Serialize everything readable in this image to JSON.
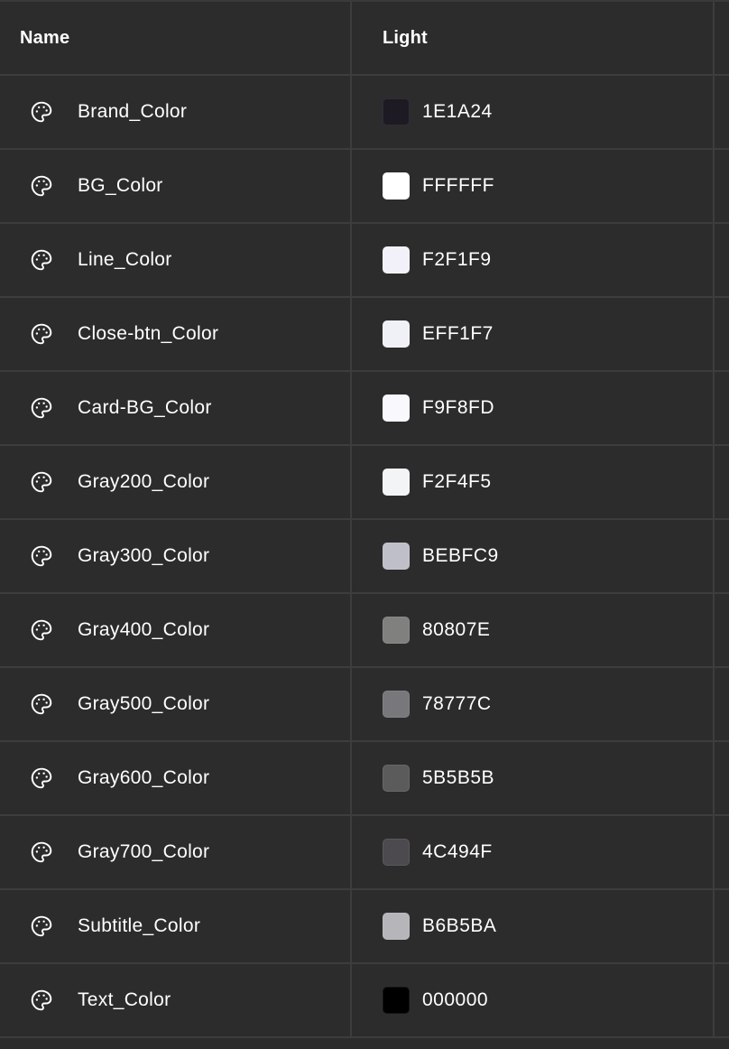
{
  "header": {
    "name_label": "Name",
    "light_label": "Light"
  },
  "rows": [
    {
      "name": "Brand_Color",
      "hex": "1E1A24",
      "swatch": "#1E1A24",
      "icon": "palette-icon"
    },
    {
      "name": "BG_Color",
      "hex": "FFFFFF",
      "swatch": "#FFFFFF",
      "icon": "palette-icon"
    },
    {
      "name": "Line_Color",
      "hex": "F2F1F9",
      "swatch": "#F2F1F9",
      "icon": "palette-icon"
    },
    {
      "name": "Close-btn_Color",
      "hex": "EFF1F7",
      "swatch": "#EFF1F7",
      "icon": "palette-icon"
    },
    {
      "name": "Card-BG_Color",
      "hex": "F9F8FD",
      "swatch": "#F9F8FD",
      "icon": "palette-icon"
    },
    {
      "name": "Gray200_Color",
      "hex": "F2F4F5",
      "swatch": "#F2F4F5",
      "icon": "palette-icon"
    },
    {
      "name": "Gray300_Color",
      "hex": "BEBFC9",
      "swatch": "#BEBFC9",
      "icon": "palette-icon"
    },
    {
      "name": "Gray400_Color",
      "hex": "80807E",
      "swatch": "#80807E",
      "icon": "palette-icon"
    },
    {
      "name": "Gray500_Color",
      "hex": "78777C",
      "swatch": "#78777C",
      "icon": "palette-icon"
    },
    {
      "name": "Gray600_Color",
      "hex": "5B5B5B",
      "swatch": "#5B5B5B",
      "icon": "palette-icon"
    },
    {
      "name": "Gray700_Color",
      "hex": "4C494F",
      "swatch": "#4C494F",
      "icon": "palette-icon"
    },
    {
      "name": "Subtitle_Color",
      "hex": "B6B5BA",
      "swatch": "#B6B5BA",
      "icon": "palette-icon"
    },
    {
      "name": "Text_Color",
      "hex": "000000",
      "swatch": "#000000",
      "icon": "palette-icon"
    }
  ],
  "colors": {
    "background": "#2c2c2c",
    "grid_line": "#3d3d3d",
    "text": "#ffffff"
  }
}
